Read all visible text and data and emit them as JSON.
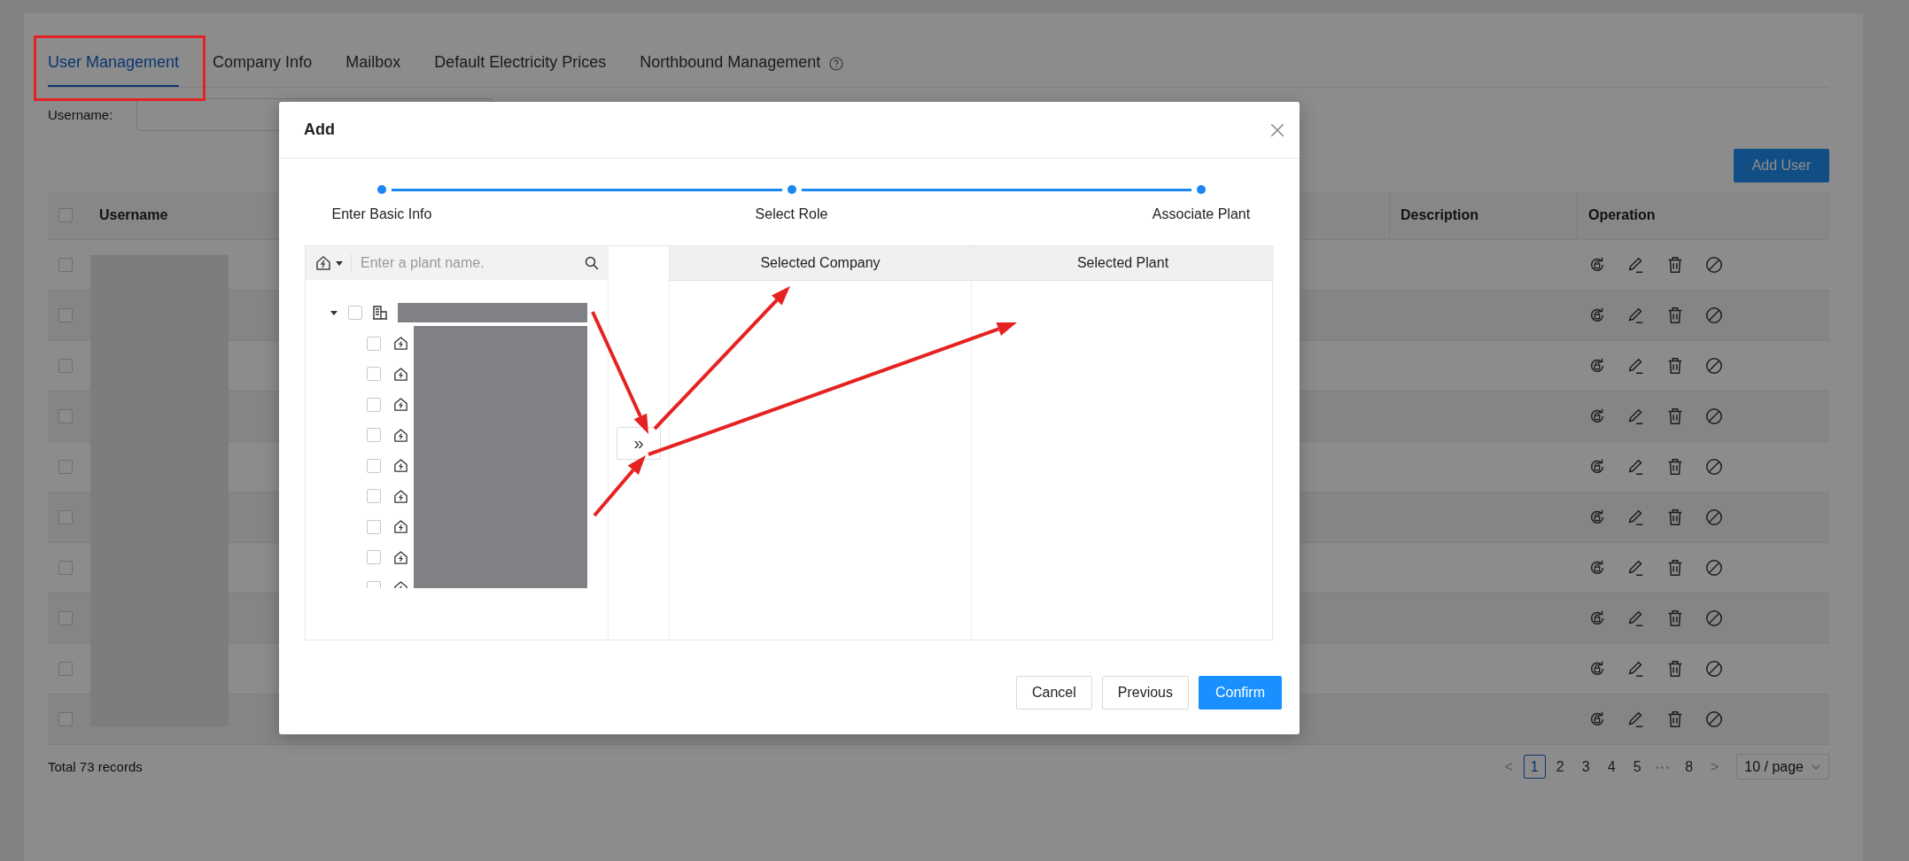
{
  "tabs": [
    {
      "label": "User Management",
      "selected": true,
      "help": false
    },
    {
      "label": "Company Info",
      "selected": false,
      "help": false
    },
    {
      "label": "Mailbox",
      "selected": false,
      "help": false
    },
    {
      "label": "Default Electricity Prices",
      "selected": false,
      "help": false
    },
    {
      "label": "Northbound Management",
      "selected": false,
      "help": true
    }
  ],
  "filter": {
    "label": "Username:"
  },
  "add_button": "Add User",
  "table": {
    "header_checked": false,
    "columns": [
      "Username",
      "Description",
      "Operation"
    ],
    "rows": [
      {
        "checked": false
      },
      {
        "checked": false
      },
      {
        "checked": false
      },
      {
        "checked": false
      },
      {
        "checked": false
      },
      {
        "checked": false
      },
      {
        "checked": false
      },
      {
        "checked": false
      },
      {
        "checked": false
      },
      {
        "checked": false
      }
    ]
  },
  "total": "Total 73 records",
  "pagination": {
    "prev": "<",
    "pages": [
      {
        "label": "1",
        "selected": true
      },
      {
        "label": "2",
        "selected": false
      },
      {
        "label": "3",
        "selected": false
      },
      {
        "label": "4",
        "selected": false
      },
      {
        "label": "5",
        "selected": false
      }
    ],
    "ellipsis": "•••",
    "last": {
      "label": "8",
      "selected": false
    },
    "next": ">",
    "page_size": "10 / page"
  },
  "dialog": {
    "title": "Add",
    "steps": [
      "Enter Basic Info",
      "Select Role",
      "Associate Plant"
    ],
    "search": {
      "placeholder": "Enter a plant name."
    },
    "tree": {
      "expanded": true,
      "checked": false,
      "children": [
        {
          "checked": false
        },
        {
          "checked": false
        },
        {
          "checked": false
        },
        {
          "checked": false
        },
        {
          "checked": false
        },
        {
          "checked": false
        },
        {
          "checked": false
        },
        {
          "checked": false
        },
        {
          "checked": false
        }
      ]
    },
    "move_button": "»",
    "targets": [
      "Selected Company",
      "Selected Plant"
    ],
    "buttons": [
      {
        "label": "Cancel",
        "kind": "default"
      },
      {
        "label": "Previous",
        "kind": "default"
      },
      {
        "label": "Confirm",
        "kind": "primary"
      }
    ]
  }
}
